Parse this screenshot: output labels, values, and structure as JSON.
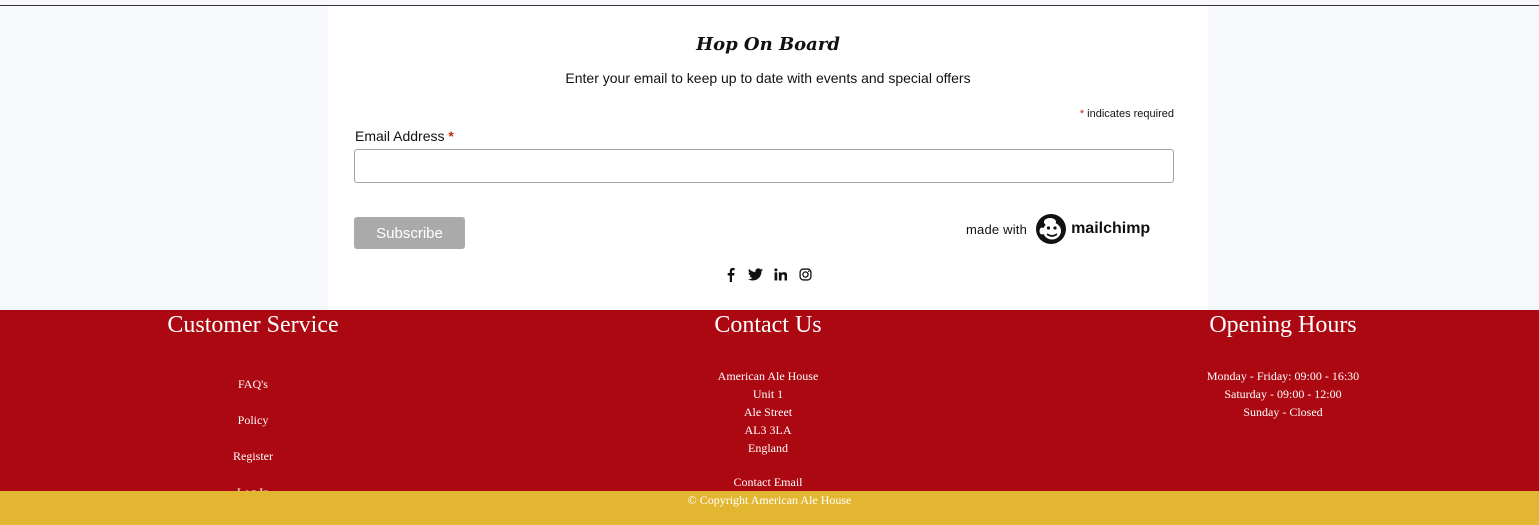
{
  "signup": {
    "title": "Hop On Board",
    "subtitle": "Enter your email to keep up to date with events and special offers",
    "required_star": "*",
    "required_note": " indicates required",
    "email_label": "Email Address ",
    "email_star": "*",
    "email_value": "",
    "subscribe_label": "Subscribe",
    "made_with": "made with",
    "mailchimp": "mailchimp"
  },
  "socials": [
    {
      "icon": "facebook-icon"
    },
    {
      "icon": "twitter-icon"
    },
    {
      "icon": "linkedin-icon"
    },
    {
      "icon": "instagram-icon"
    }
  ],
  "footer": {
    "customer_service": {
      "title": "Customer Service",
      "links": [
        "FAQ's",
        "Policy",
        "Register",
        "Log In"
      ]
    },
    "contact": {
      "title": "Contact Us",
      "address": [
        "American Ale House",
        "Unit 1",
        "Ale Street",
        "AL3 3LA",
        "England"
      ],
      "email_link": "Contact Email"
    },
    "hours": {
      "title": "Opening Hours",
      "lines": [
        "Monday - Friday: 09:00 - 16:30",
        "Saturday - 09:00 - 12:00",
        "Sunday - Closed"
      ]
    },
    "copyright": "© Copyright American Ale House"
  },
  "colors": {
    "footer_red": "#ab0811",
    "footer_gold": "#e3b631",
    "required_red": "#c02b0a",
    "button_grey": "#aaaaaa"
  }
}
